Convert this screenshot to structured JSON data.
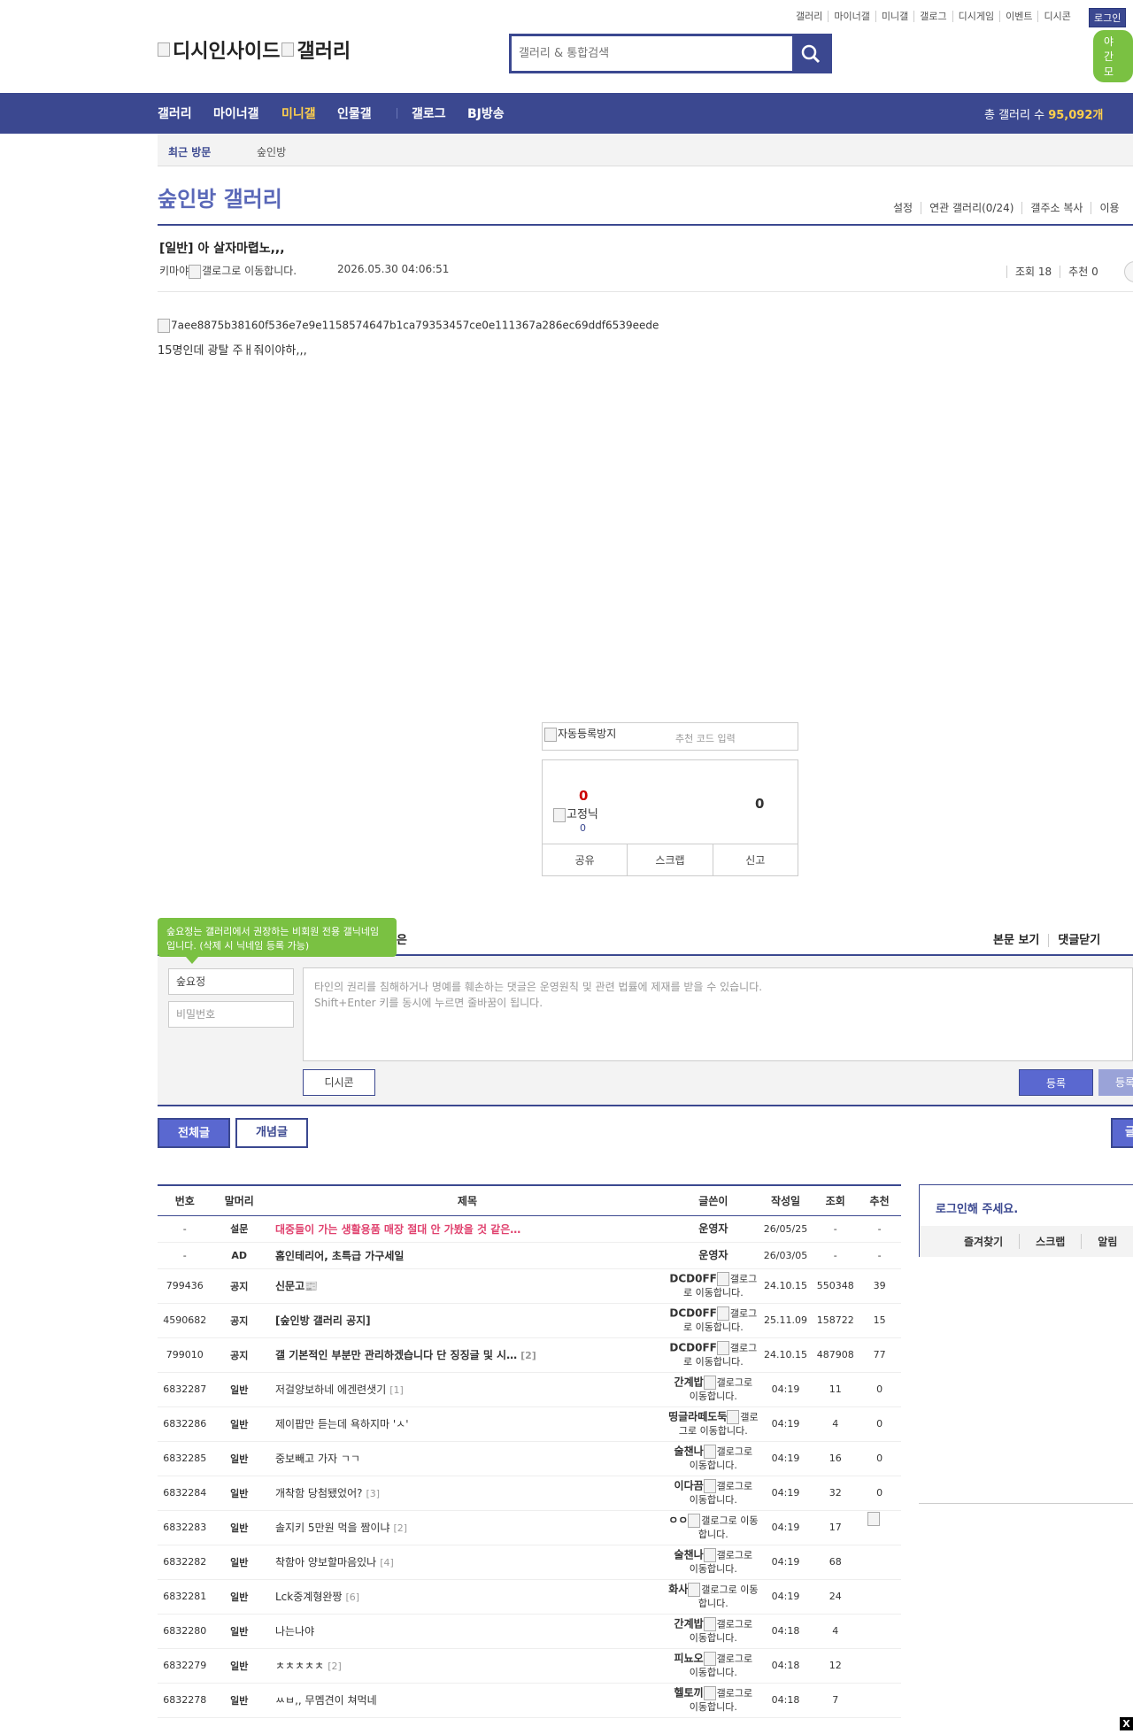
{
  "top": {
    "links": [
      "갤러리",
      "마이너갤",
      "미니갤",
      "갤로그",
      "디시게임",
      "이벤트",
      "디시콘"
    ],
    "login": "로그인",
    "night": "야간 모"
  },
  "logo": {
    "alt1": "디시인사이드",
    "alt2": "갤러리"
  },
  "search": {
    "placeholder": "갤러리 & 통합검색"
  },
  "nav": {
    "items": [
      "갤러리",
      "마이너갤",
      "미니갤",
      "인물갤",
      "갤로그",
      "BJ방송"
    ],
    "count_label": "총 갤러리 수",
    "count_value": "95,092개"
  },
  "subnav": {
    "recent": "최근 방문",
    "item": "숲인방"
  },
  "gallery": {
    "title": "숲인방 갤러리",
    "tools": [
      "설정",
      "연관 갤러리(0/24)",
      "갤주소 복사",
      "이용"
    ]
  },
  "post": {
    "title": "[일반] 아 살자마렵노,,,",
    "writer": "키마야",
    "gallog_alt": "갤로그로 이동합니다.",
    "date": "2026.05.30 04:06:51",
    "views": "조회 18",
    "recommend": "추천 0",
    "image_alt": "7aee8875b38160f536e7e9e1158574647b1ca79353457ce0e111367a286ec69ddf6539eede",
    "body": "15명인데 광탈 주ㅐ줘이야하,,,"
  },
  "recommend": {
    "captcha_alt": "자동등록방지",
    "code_placeholder": "추천 코드 입력",
    "up": "0",
    "fixed_alt": "고정닉",
    "fixed_count": "0",
    "down": "0",
    "actions": [
      "공유",
      "스크랩",
      "신고"
    ]
  },
  "comment": {
    "tooltip": "숲요정는 갤러리에서 권장하는 비회원 전용 갤닉네임입니다. (삭제 시 닉네임 등록 가능)",
    "tooltip_tail": "은",
    "view_links": [
      "본문 보기",
      "댓글닫기"
    ],
    "nickname": "숲요정",
    "password_placeholder": "비밀번호",
    "textarea_line1": "타인의 권리를 침해하거나 명예를 훼손하는 댓글은 운영원칙 및 관련 법률에 제재를 받을 수 있습니다.",
    "textarea_line2": "Shift+Enter 키를 동시에 누르면 줄바꿈이 됩니다.",
    "dccon": "디시콘",
    "register": "등록",
    "register2": "등록"
  },
  "tabs": {
    "all": "전체글",
    "concept": "개념글",
    "right": "글"
  },
  "table": {
    "headers": [
      "번호",
      "말머리",
      "제목",
      "글쓴이",
      "작성일",
      "조회",
      "추천"
    ],
    "rows": [
      {
        "no": "-",
        "head": "설문",
        "title": "대중들이 가는 생활용품 매장 절대 안 가봤을 것 같은…",
        "replies": "",
        "writer": "운영자",
        "gallog": "",
        "date": "26/05/25",
        "views": "-",
        "rec": "-",
        "style": "survey"
      },
      {
        "no": "-",
        "head": "AD",
        "title": "홈인테리어, 초특급 가구세일",
        "replies": "",
        "writer": "운영자",
        "gallog": "",
        "date": "26/03/05",
        "views": "-",
        "rec": "-",
        "style": "bold"
      },
      {
        "no": "799436",
        "head": "공지",
        "title": "신문고📰",
        "replies": "",
        "writer": "DCD0FF",
        "gallog": "갤로그로 이동합니다.",
        "date": "24.10.15",
        "views": "550348",
        "rec": "39",
        "style": "bold"
      },
      {
        "no": "4590682",
        "head": "공지",
        "title": "[숲인방 갤러리 공지]",
        "replies": "",
        "writer": "DCD0FF",
        "gallog": "갤로그로 이동합니다.",
        "date": "25.11.09",
        "views": "158722",
        "rec": "15",
        "style": "bold"
      },
      {
        "no": "799010",
        "head": "공지",
        "title": "갤 기본적인 부분만 관리하겠습니다 단 징징글 및 시…",
        "replies": "[2]",
        "writer": "DCD0FF",
        "gallog": "갤로그로 이동합니다.",
        "date": "24.10.15",
        "views": "487908",
        "rec": "77",
        "style": "bold"
      },
      {
        "no": "6832287",
        "head": "일반",
        "title": "저걸양보하네 에겐련샛기",
        "replies": "[1]",
        "writer": "간계밥",
        "gallog": "갤로그로 이동합니다.",
        "date": "04:19",
        "views": "11",
        "rec": "0",
        "style": ""
      },
      {
        "no": "6832286",
        "head": "일반",
        "title": "제이팝만 듣는데 욕하지마 'ㅅ'",
        "replies": "",
        "writer": "띵글라떼도둑",
        "gallog": "갤로그로 이동합니다.",
        "date": "04:19",
        "views": "4",
        "rec": "0",
        "style": ""
      },
      {
        "no": "6832285",
        "head": "일반",
        "title": "중보빼고 가자 ㄱㄱ",
        "replies": "",
        "writer": "술챈나",
        "gallog": "갤로그로 이동합니다.",
        "date": "04:19",
        "views": "16",
        "rec": "0",
        "style": ""
      },
      {
        "no": "6832284",
        "head": "일반",
        "title": "개착함 당첨됐었어?",
        "replies": "[3]",
        "writer": "이다끔",
        "gallog": "갤로그로 이동합니다.",
        "date": "04:19",
        "views": "32",
        "rec": "0",
        "style": ""
      },
      {
        "no": "6832283",
        "head": "일반",
        "title": "솔지키 5만원 먹을 짬이냐",
        "replies": "[2]",
        "writer": "ㅇㅇ",
        "gallog": "갤로그로 이동합니다.",
        "date": "04:19",
        "views": "17",
        "rec": "",
        "style": ""
      },
      {
        "no": "6832282",
        "head": "일반",
        "title": "착함아 양보할마음있나",
        "replies": "[4]",
        "writer": "술챈나",
        "gallog": "갤로그로 이동합니다.",
        "date": "04:19",
        "views": "68",
        "rec": "",
        "style": ""
      },
      {
        "no": "6832281",
        "head": "일반",
        "title": "Lck중계형완짱",
        "replies": "[6]",
        "writer": "화사",
        "gallog": "갤로그로 이동합니다.",
        "date": "04:19",
        "views": "24",
        "rec": "",
        "style": ""
      },
      {
        "no": "6832280",
        "head": "일반",
        "title": "나는나야",
        "replies": "",
        "writer": "간계밥",
        "gallog": "갤로그로 이동합니다.",
        "date": "04:18",
        "views": "4",
        "rec": "",
        "style": ""
      },
      {
        "no": "6832279",
        "head": "일반",
        "title": "ㅊㅊㅊㅊㅊ",
        "replies": "[2]",
        "writer": "피뇨오",
        "gallog": "갤로그로 이동합니다.",
        "date": "04:18",
        "views": "12",
        "rec": "",
        "style": ""
      },
      {
        "no": "6832278",
        "head": "일반",
        "title": "ㅆㅂ,, 무멤견이 쳐먹네",
        "replies": "",
        "writer": "헬토끼",
        "gallog": "갤로그로 이동합니다.",
        "date": "04:18",
        "views": "7",
        "rec": "",
        "style": ""
      }
    ]
  },
  "side": {
    "login_title": "로그인해 주세요.",
    "login_menu": [
      "즐겨찾기",
      "스크랩",
      "알림"
    ]
  },
  "close": "X",
  "colors": {
    "primary": "#3b4890",
    "accent": "#ffd04c",
    "green": "#7ac142",
    "survey": "#e0416e"
  }
}
